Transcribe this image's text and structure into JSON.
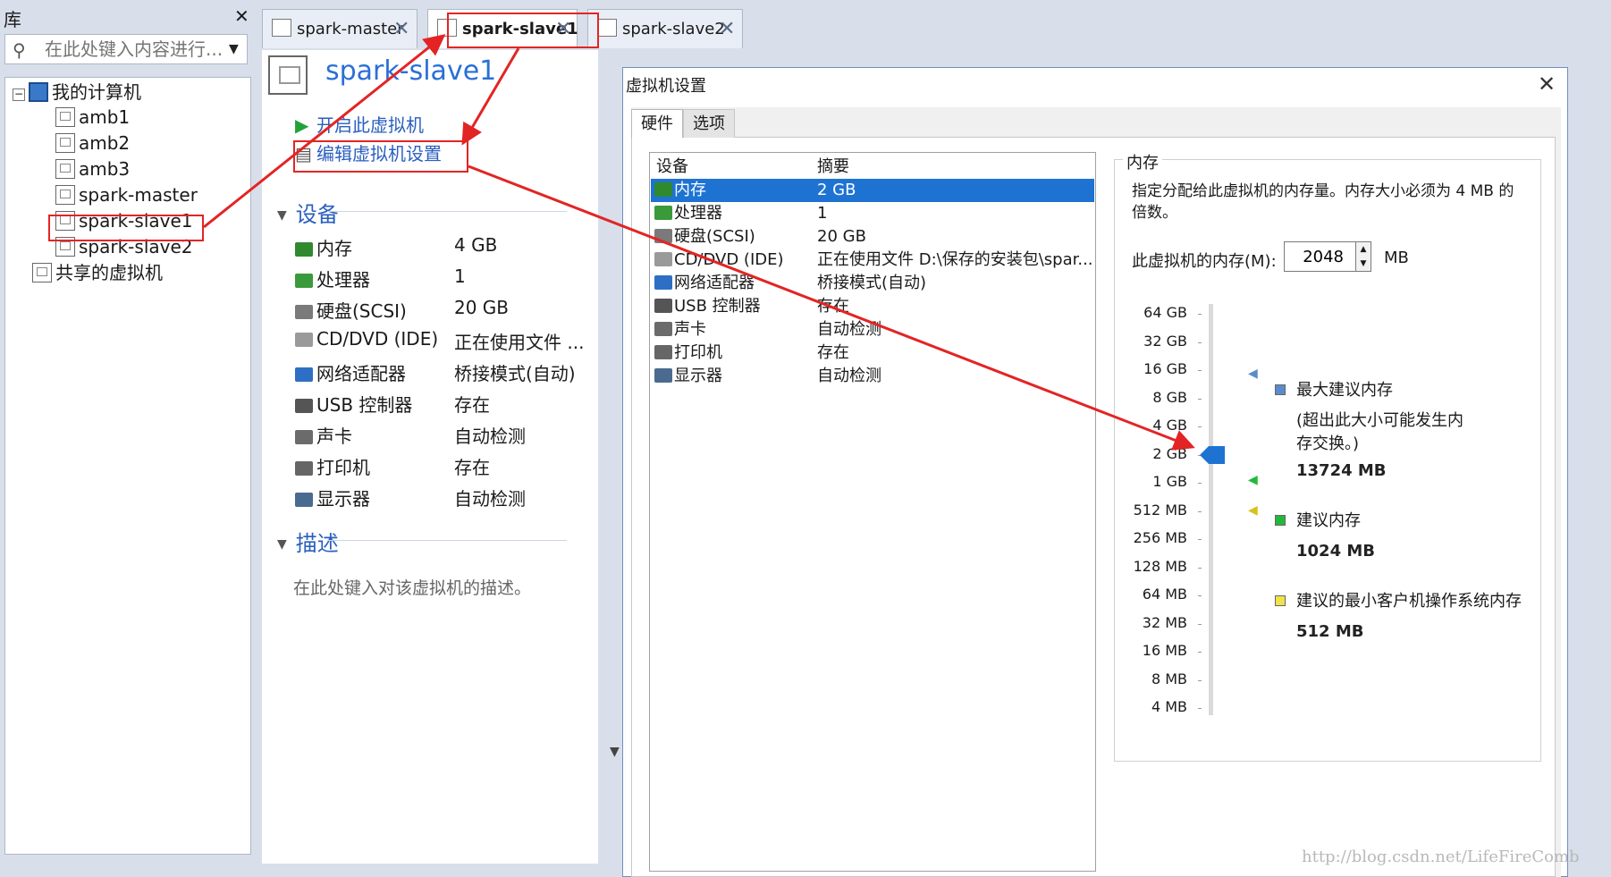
{
  "library": {
    "title": "库",
    "search_placeholder": "在此处键入内容进行...",
    "tree": {
      "root": "我的计算机",
      "vms": [
        "amb1",
        "amb2",
        "amb3",
        "spark-master",
        "spark-slave1",
        "spark-slave2"
      ],
      "shared": "共享的虚拟机"
    }
  },
  "tabs": [
    {
      "label": "spark-master"
    },
    {
      "label": "spark-slave1"
    },
    {
      "label": "spark-slave2"
    }
  ],
  "vm": {
    "name": "spark-slave1",
    "actions": {
      "start": "开启此虚拟机",
      "edit": "编辑虚拟机设置"
    },
    "devices_header": "设备",
    "devices": [
      {
        "name": "内存",
        "value": "4 GB",
        "icon": "memory-icon"
      },
      {
        "name": "处理器",
        "value": "1",
        "icon": "cpu-icon"
      },
      {
        "name": "硬盘(SCSI)",
        "value": "20 GB",
        "icon": "disk-icon"
      },
      {
        "name": "CD/DVD (IDE)",
        "value": "正在使用文件 ...",
        "icon": "cdrom-icon"
      },
      {
        "name": "网络适配器",
        "value": "桥接模式(自动)",
        "icon": "network-icon"
      },
      {
        "name": "USB 控制器",
        "value": "存在",
        "icon": "usb-icon"
      },
      {
        "name": "声卡",
        "value": "自动检测",
        "icon": "sound-icon"
      },
      {
        "name": "打印机",
        "value": "存在",
        "icon": "printer-icon"
      },
      {
        "name": "显示器",
        "value": "自动检测",
        "icon": "display-icon"
      }
    ],
    "description_header": "描述",
    "description_placeholder": "在此处键入对该虚拟机的描述。"
  },
  "dialog": {
    "title": "虚拟机设置",
    "tabs": {
      "hardware": "硬件",
      "options": "选项"
    },
    "list_headers": {
      "device": "设备",
      "summary": "摘要"
    },
    "hardware": [
      {
        "name": "内存",
        "value": "2 GB",
        "icon": "memory-icon",
        "selected": true
      },
      {
        "name": "处理器",
        "value": "1",
        "icon": "cpu-icon"
      },
      {
        "name": "硬盘(SCSI)",
        "value": "20 GB",
        "icon": "disk-icon"
      },
      {
        "name": "CD/DVD (IDE)",
        "value": "正在使用文件 D:\\保存的安装包\\spar...",
        "icon": "cdrom-icon"
      },
      {
        "name": "网络适配器",
        "value": "桥接模式(自动)",
        "icon": "network-icon"
      },
      {
        "name": "USB 控制器",
        "value": "存在",
        "icon": "usb-icon"
      },
      {
        "name": "声卡",
        "value": "自动检测",
        "icon": "sound-icon"
      },
      {
        "name": "打印机",
        "value": "存在",
        "icon": "printer-icon"
      },
      {
        "name": "显示器",
        "value": "自动检测",
        "icon": "display-icon"
      }
    ],
    "memory": {
      "group_title": "内存",
      "description": "指定分配给此虚拟机的内存量。内存大小必须为 4 MB 的倍数。",
      "field_label": "此虚拟机的内存(M):",
      "value": "2048",
      "unit": "MB",
      "scale": [
        "64 GB",
        "32 GB",
        "16 GB",
        "8 GB",
        "4 GB",
        "2 GB",
        "1 GB",
        "512 MB",
        "256 MB",
        "128 MB",
        "64 MB",
        "32 MB",
        "16 MB",
        "8 MB",
        "4 MB"
      ],
      "selected_scale": "2 GB",
      "legend": {
        "max_title": "最大建议内存",
        "max_note": "(超出此大小可能发生内存交换。)",
        "max_value": "13724 MB",
        "rec_title": "建议内存",
        "rec_value": "1024 MB",
        "min_title": "建议的最小客户机操作系统内存",
        "min_value": "512 MB"
      },
      "colors": {
        "max": "#5a8ccc",
        "recommended": "#22b83a",
        "minimum": "#f0e24a",
        "thumb": "#1e73d2"
      }
    }
  },
  "watermark": "http://blog.csdn.net/LifeFireComb"
}
